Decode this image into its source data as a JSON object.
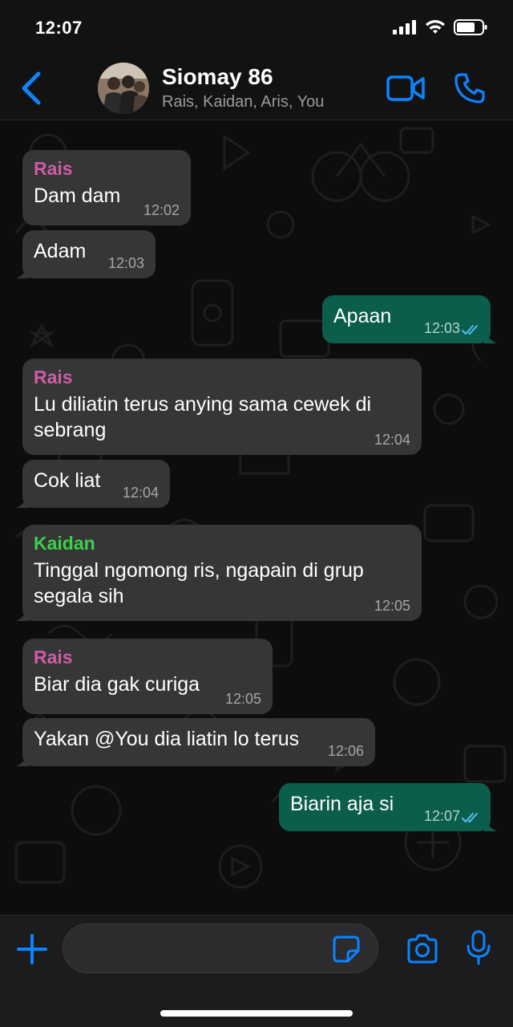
{
  "status_bar": {
    "time": "12:07"
  },
  "header": {
    "title": "Siomay 86",
    "subtitle": "Rais, Kaidan, Aris, You"
  },
  "colors": {
    "accent": "#0a84ff",
    "rais": "#d05ca5",
    "kaidan": "#3ecf4b",
    "incoming_bubble": "#363638",
    "outgoing_bubble": "#0b5d4c"
  },
  "messages": [
    {
      "sender": "Rais",
      "text": "Dam dam",
      "time": "12:02"
    },
    {
      "text": "Adam",
      "time": "12:03"
    },
    {
      "text": "Apaan",
      "time": "12:03"
    },
    {
      "sender": "Rais",
      "text": "Lu diliatin terus anying sama cewek di sebrang",
      "time": "12:04"
    },
    {
      "text": "Cok liat",
      "time": "12:04"
    },
    {
      "sender": "Kaidan",
      "text": "Tinggal ngomong ris, ngapain di grup segala sih",
      "time": "12:05"
    },
    {
      "sender": "Rais",
      "text": "Biar dia gak curiga",
      "time": "12:05"
    },
    {
      "text": "Yakan @You dia liatin lo terus",
      "time": "12:06"
    },
    {
      "text": "Biarin aja si",
      "time": "12:07"
    }
  ],
  "input": {
    "placeholder": ""
  },
  "icons": {
    "back": "chevron-left-icon",
    "video": "video-camera-icon",
    "call": "phone-icon",
    "plus": "plus-icon",
    "sticker": "sticker-icon",
    "camera": "camera-icon",
    "mic": "microphone-icon"
  }
}
